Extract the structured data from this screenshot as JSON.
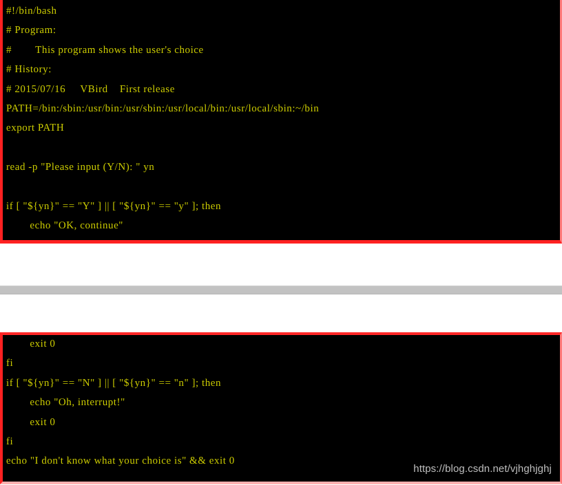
{
  "page": {
    "background": "#ffffff",
    "code_text_color": "#cdcd00",
    "code_background": "#000000",
    "highlight_border_color": "#ff2121",
    "separator_color": "#c2c2c2"
  },
  "blocks": [
    {
      "id": "block-one",
      "name": "bash-script-top-half",
      "lines": [
        "#!/bin/bash",
        "# Program:",
        "#        This program shows the user's choice",
        "# History:",
        "# 2015/07/16     VBird    First release",
        "PATH=/bin:/sbin:/usr/bin:/usr/sbin:/usr/local/bin:/usr/local/sbin:~/bin",
        "export PATH",
        "",
        "read -p \"Please input (Y/N): \" yn",
        "",
        "if [ \"${yn}\" == \"Y\" ] || [ \"${yn}\" == \"y\" ]; then",
        "        echo \"OK, continue\""
      ]
    },
    {
      "id": "block-two",
      "name": "bash-script-bottom-half",
      "lines": [
        "        exit 0",
        "fi",
        "if [ \"${yn}\" == \"N\" ] || [ \"${yn}\" == \"n\" ]; then",
        "        echo \"Oh, interrupt!\"",
        "        exit 0",
        "fi",
        "echo \"I don't know what your choice is\" && exit 0"
      ]
    }
  ],
  "watermark": {
    "text": "https://blog.csdn.net/vjhghjghj"
  }
}
